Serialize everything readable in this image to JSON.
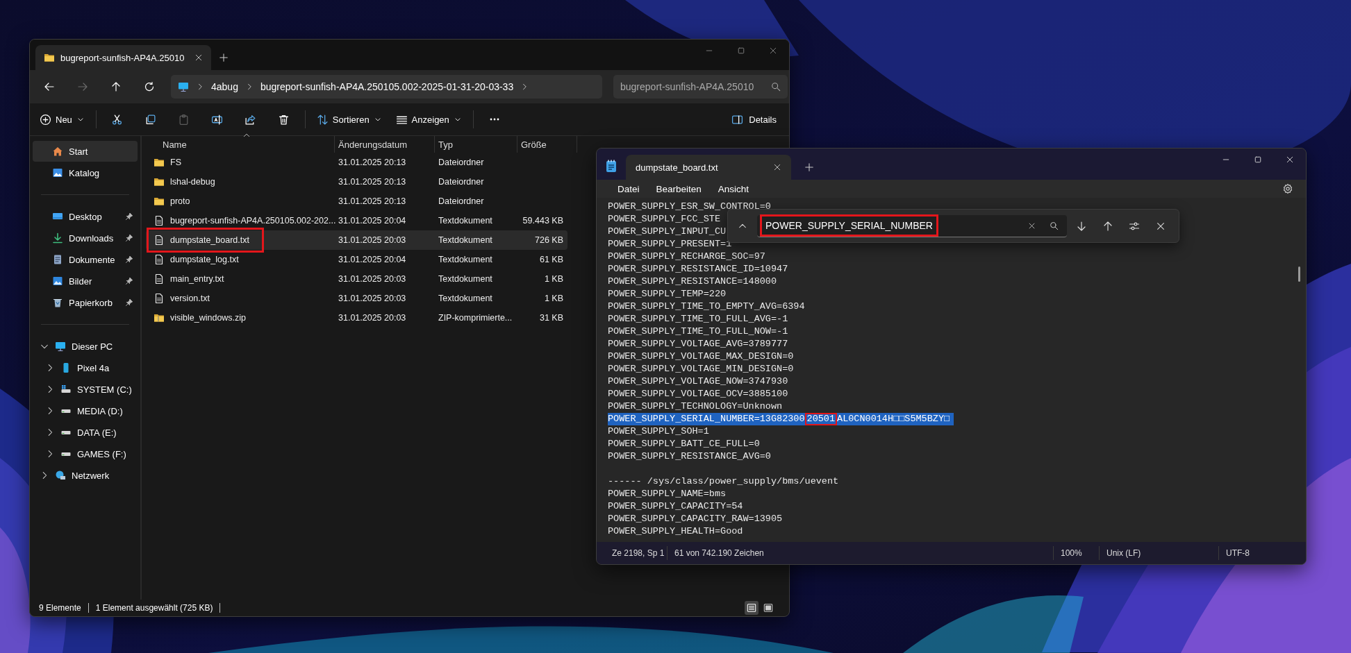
{
  "explorer": {
    "tabs": [
      {
        "title": "bugreport-sunfish-AP4A.25010",
        "selected": true
      }
    ],
    "nav": [
      {
        "kind": "back",
        "disabled": false
      },
      {
        "kind": "forward",
        "disabled": true
      },
      {
        "kind": "up",
        "disabled": false
      },
      {
        "kind": "refresh",
        "disabled": false
      }
    ],
    "breadcrumbs": [
      "4abug",
      "bugreport-sunfish-AP4A.250105.002-2025-01-31-20-03-33"
    ],
    "search": {
      "placeholder": "bugreport-sunfish-AP4A.25010"
    },
    "toolbar_groups": [
      {
        "items": [
          {
            "kind": "new",
            "label": "Neu",
            "dropdown": true,
            "disabled": false
          }
        ]
      },
      {
        "items": [
          {
            "kind": "cut",
            "disabled": false
          },
          {
            "kind": "copy",
            "disabled": false
          },
          {
            "kind": "paste",
            "disabled": true
          },
          {
            "kind": "rename",
            "disabled": false
          },
          {
            "kind": "share",
            "disabled": false
          },
          {
            "kind": "delete",
            "disabled": false
          }
        ]
      },
      {
        "items": [
          {
            "kind": "sort",
            "label": "Sortieren",
            "dropdown": true,
            "disabled": false
          },
          {
            "kind": "view",
            "label": "Anzeigen",
            "dropdown": true,
            "disabled": false
          }
        ]
      },
      {
        "items": [
          {
            "kind": "more",
            "disabled": false
          }
        ]
      }
    ],
    "details_button": "Details",
    "sidebar_groups": [
      {
        "items": [
          {
            "kind": "home",
            "label": "Start",
            "selected": true,
            "pinned": false
          },
          {
            "kind": "gallery",
            "label": "Katalog",
            "selected": false,
            "pinned": false
          }
        ]
      },
      {
        "items": [
          {
            "kind": "desktop",
            "label": "Desktop",
            "selected": false,
            "pinned": true
          },
          {
            "kind": "downloads",
            "label": "Downloads",
            "selected": false,
            "pinned": true
          },
          {
            "kind": "documents",
            "label": "Dokumente",
            "selected": false,
            "pinned": true
          },
          {
            "kind": "pictures",
            "label": "Bilder",
            "selected": false,
            "pinned": true
          },
          {
            "kind": "recycle",
            "label": "Papierkorb",
            "selected": false,
            "pinned": true
          }
        ]
      }
    ],
    "tree": [
      {
        "kind": "pc",
        "label": "Dieser PC",
        "expanded": true,
        "selected": false,
        "children": [
          {
            "kind": "phone",
            "label": "Pixel 4a",
            "expanded": false,
            "selected": false
          },
          {
            "kind": "system_drive",
            "label": "SYSTEM (C:)",
            "expanded": false,
            "selected": false
          },
          {
            "kind": "drive",
            "label": "MEDIA (D:)",
            "expanded": false,
            "selected": false
          },
          {
            "kind": "drive",
            "label": "DATA (E:)",
            "expanded": false,
            "selected": false
          },
          {
            "kind": "drive",
            "label": "GAMES (F:)",
            "expanded": false,
            "selected": false
          }
        ]
      },
      {
        "kind": "network",
        "label": "Netzwerk",
        "expanded": false,
        "selected": false
      }
    ],
    "columns": [
      {
        "label": "Name",
        "sorted": true
      },
      {
        "label": "Änderungsdatum",
        "sorted": false
      },
      {
        "label": "Typ",
        "sorted": false
      },
      {
        "label": "Größe",
        "sorted": false
      }
    ],
    "rows": [
      {
        "kind": "folder",
        "name": "FS",
        "date": "31.01.2025 20:13",
        "type": "Dateiordner",
        "selected": false,
        "boxed": false
      },
      {
        "kind": "folder",
        "name": "lshal-debug",
        "date": "31.01.2025 20:13",
        "type": "Dateiordner",
        "selected": false,
        "boxed": false
      },
      {
        "kind": "folder",
        "name": "proto",
        "date": "31.01.2025 20:13",
        "type": "Dateiordner",
        "selected": false,
        "boxed": false
      },
      {
        "kind": "file",
        "name": "bugreport-sunfish-AP4A.250105.002-202...",
        "date": "31.01.2025 20:04",
        "type": "Textdokument",
        "size": "59.443 KB",
        "selected": false,
        "boxed": false
      },
      {
        "kind": "file",
        "name": "dumpstate_board.txt",
        "date": "31.01.2025 20:03",
        "type": "Textdokument",
        "size": "726 KB",
        "selected": true,
        "boxed": true
      },
      {
        "kind": "file",
        "name": "dumpstate_log.txt",
        "date": "31.01.2025 20:04",
        "type": "Textdokument",
        "size": "61 KB",
        "selected": false,
        "boxed": false
      },
      {
        "kind": "file",
        "name": "main_entry.txt",
        "date": "31.01.2025 20:03",
        "type": "Textdokument",
        "size": "1 KB",
        "selected": false,
        "boxed": false
      },
      {
        "kind": "file",
        "name": "version.txt",
        "date": "31.01.2025 20:03",
        "type": "Textdokument",
        "size": "1 KB",
        "selected": false,
        "boxed": false
      },
      {
        "kind": "zip",
        "name": "visible_windows.zip",
        "date": "31.01.2025 20:03",
        "type": "ZIP-komprimierte...",
        "size": "31 KB",
        "selected": false,
        "boxed": false
      }
    ],
    "status": [
      "9 Elemente",
      "1 Element ausgewählt (725 KB)"
    ],
    "views": [
      {
        "kind": "details",
        "selected": true
      },
      {
        "kind": "tiles",
        "selected": false
      }
    ]
  },
  "notepad": {
    "tabs": [
      {
        "title": "dumpstate_board.txt",
        "selected": true
      }
    ],
    "menu": [
      "Datei",
      "Bearbeiten",
      "Ansicht"
    ],
    "blocks": [
      {
        "lines": [
          {
            "text": "POWER_SUPPLY_ESR_SW_CONTROL=0",
            "selected": false
          },
          {
            "text": "POWER_SUPPLY_FCC_STE",
            "selected": false
          },
          {
            "text": "POWER_SUPPLY_INPUT_CU",
            "selected": false
          },
          {
            "text": "POWER_SUPPLY_PRESENT=1",
            "selected": false
          },
          {
            "text": "POWER_SUPPLY_RECHARGE_SOC=97",
            "selected": false
          },
          {
            "text": "POWER_SUPPLY_RESISTANCE_ID=10947",
            "selected": false
          },
          {
            "text": "POWER_SUPPLY_RESISTANCE=148000",
            "selected": false
          },
          {
            "text": "POWER_SUPPLY_TEMP=220",
            "selected": false
          },
          {
            "text": "POWER_SUPPLY_TIME_TO_EMPTY_AVG=6394",
            "selected": false
          },
          {
            "text": "POWER_SUPPLY_TIME_TO_FULL_AVG=-1",
            "selected": false
          },
          {
            "text": "POWER_SUPPLY_TIME_TO_FULL_NOW=-1",
            "selected": false
          },
          {
            "text": "POWER_SUPPLY_VOLTAGE_AVG=3789777",
            "selected": false
          },
          {
            "text": "POWER_SUPPLY_VOLTAGE_MAX_DESIGN=0",
            "selected": false
          },
          {
            "text": "POWER_SUPPLY_VOLTAGE_MIN_DESIGN=0",
            "selected": false
          },
          {
            "text": "POWER_SUPPLY_VOLTAGE_NOW=3747930",
            "selected": false
          },
          {
            "text": "POWER_SUPPLY_VOLTAGE_OCV=3885100",
            "selected": false
          },
          {
            "text": "POWER_SUPPLY_TECHNOLOGY=Unknown",
            "selected": false
          },
          {
            "segments": [
              {
                "text": "POWER_SUPPLY_SERIAL_NUMBER=13G82300",
                "boxed": false
              },
              {
                "text": "20501",
                "boxed": true
              },
              {
                "text": "AL0CN0014H□□S5M5BZY□",
                "boxed": false
              }
            ],
            "selected": true
          },
          {
            "text": "POWER_SUPPLY_SOH=1",
            "selected": false
          },
          {
            "text": "POWER_SUPPLY_BATT_CE_FULL=0",
            "selected": false
          },
          {
            "text": "POWER_SUPPLY_RESISTANCE_AVG=0",
            "selected": false
          }
        ]
      },
      {
        "lines": [
          {
            "text": "------ /sys/class/power_supply/bms/uevent",
            "selected": false
          },
          {
            "text": "POWER_SUPPLY_NAME=bms",
            "selected": false
          },
          {
            "text": "POWER_SUPPLY_CAPACITY=54",
            "selected": false
          },
          {
            "text": "POWER_SUPPLY_CAPACITY_RAW=13905",
            "selected": false
          },
          {
            "text": "POWER_SUPPLY_HEALTH=Good",
            "selected": false
          }
        ]
      }
    ],
    "find": {
      "value": "POWER_SUPPLY_SERIAL_NUMBER",
      "boxed": true
    },
    "status": [
      "Ze 2198, Sp 1",
      "61 von 742.190 Zeichen",
      "100%",
      "Unix (LF)",
      "UTF-8"
    ]
  }
}
